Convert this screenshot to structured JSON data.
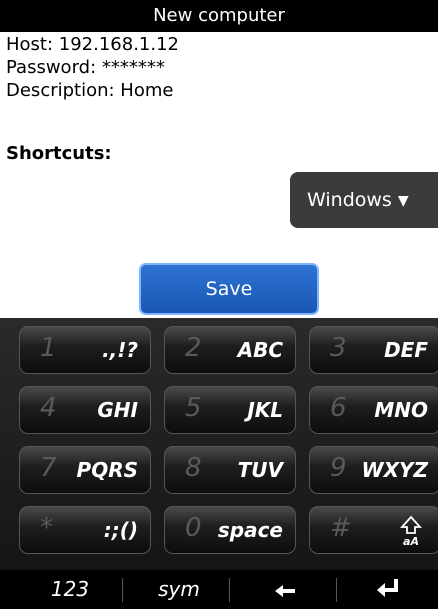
{
  "title": "New computer",
  "form": {
    "host": "Host: 192.168.1.12",
    "password": "Password: *******",
    "description": "Description: Home"
  },
  "shortcuts_label": "Shortcuts:",
  "dropdown": {
    "value": "Windows",
    "arrow": "▼"
  },
  "save_label": "Save",
  "keyboard": {
    "keys": [
      {
        "num": "1",
        "label": ".,!?"
      },
      {
        "num": "2",
        "label": "ABC"
      },
      {
        "num": "3",
        "label": "DEF"
      },
      {
        "num": "4",
        "label": "GHI"
      },
      {
        "num": "5",
        "label": "JKL"
      },
      {
        "num": "6",
        "label": "MNO"
      },
      {
        "num": "7",
        "label": "PQRS"
      },
      {
        "num": "8",
        "label": "TUV"
      },
      {
        "num": "9",
        "label": "WXYZ"
      },
      {
        "num": "*",
        "label": ":;()"
      },
      {
        "num": "0",
        "label": "space"
      },
      {
        "num": "#",
        "label": ""
      }
    ],
    "shift_icon": "shift-aA-icon",
    "bottom": {
      "numbers": "123",
      "symbols": "sym",
      "backspace_icon": "backspace-icon",
      "enter_icon": "enter-icon"
    }
  }
}
